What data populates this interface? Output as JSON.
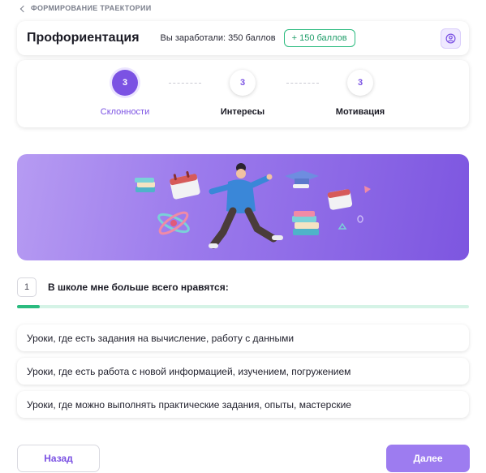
{
  "breadcrumb": {
    "label": "ФОРМИРОВАНИЕ ТРАЕКТОРИИ"
  },
  "header": {
    "title": "Профориентация",
    "earned": "Вы заработали: 350 баллов",
    "bonus": "+ 150 баллов",
    "profile_icon": "user-circle-icon"
  },
  "stepper": {
    "steps": [
      {
        "number": "3",
        "label": "Склонности",
        "state": "active"
      },
      {
        "number": "3",
        "label": "Интересы",
        "state": "inactive"
      },
      {
        "number": "3",
        "label": "Мотивация",
        "state": "inactive"
      }
    ]
  },
  "question": {
    "number": "1",
    "text": "В школе мне больше всего нравятся:",
    "progress": 0.05
  },
  "answers": [
    "Уроки, где есть задания на вычисление, работу с данными",
    "Уроки, где есть работа с новой информацией, изучением, погружением",
    "Уроки, где можно выполнять практические задания, опыты, мастерские"
  ],
  "buttons": {
    "back": "Назад",
    "next": "Далее"
  },
  "colors": {
    "accent": "#7b52e3",
    "success": "#2bbb7f",
    "next_button": "#9d7cf0"
  }
}
